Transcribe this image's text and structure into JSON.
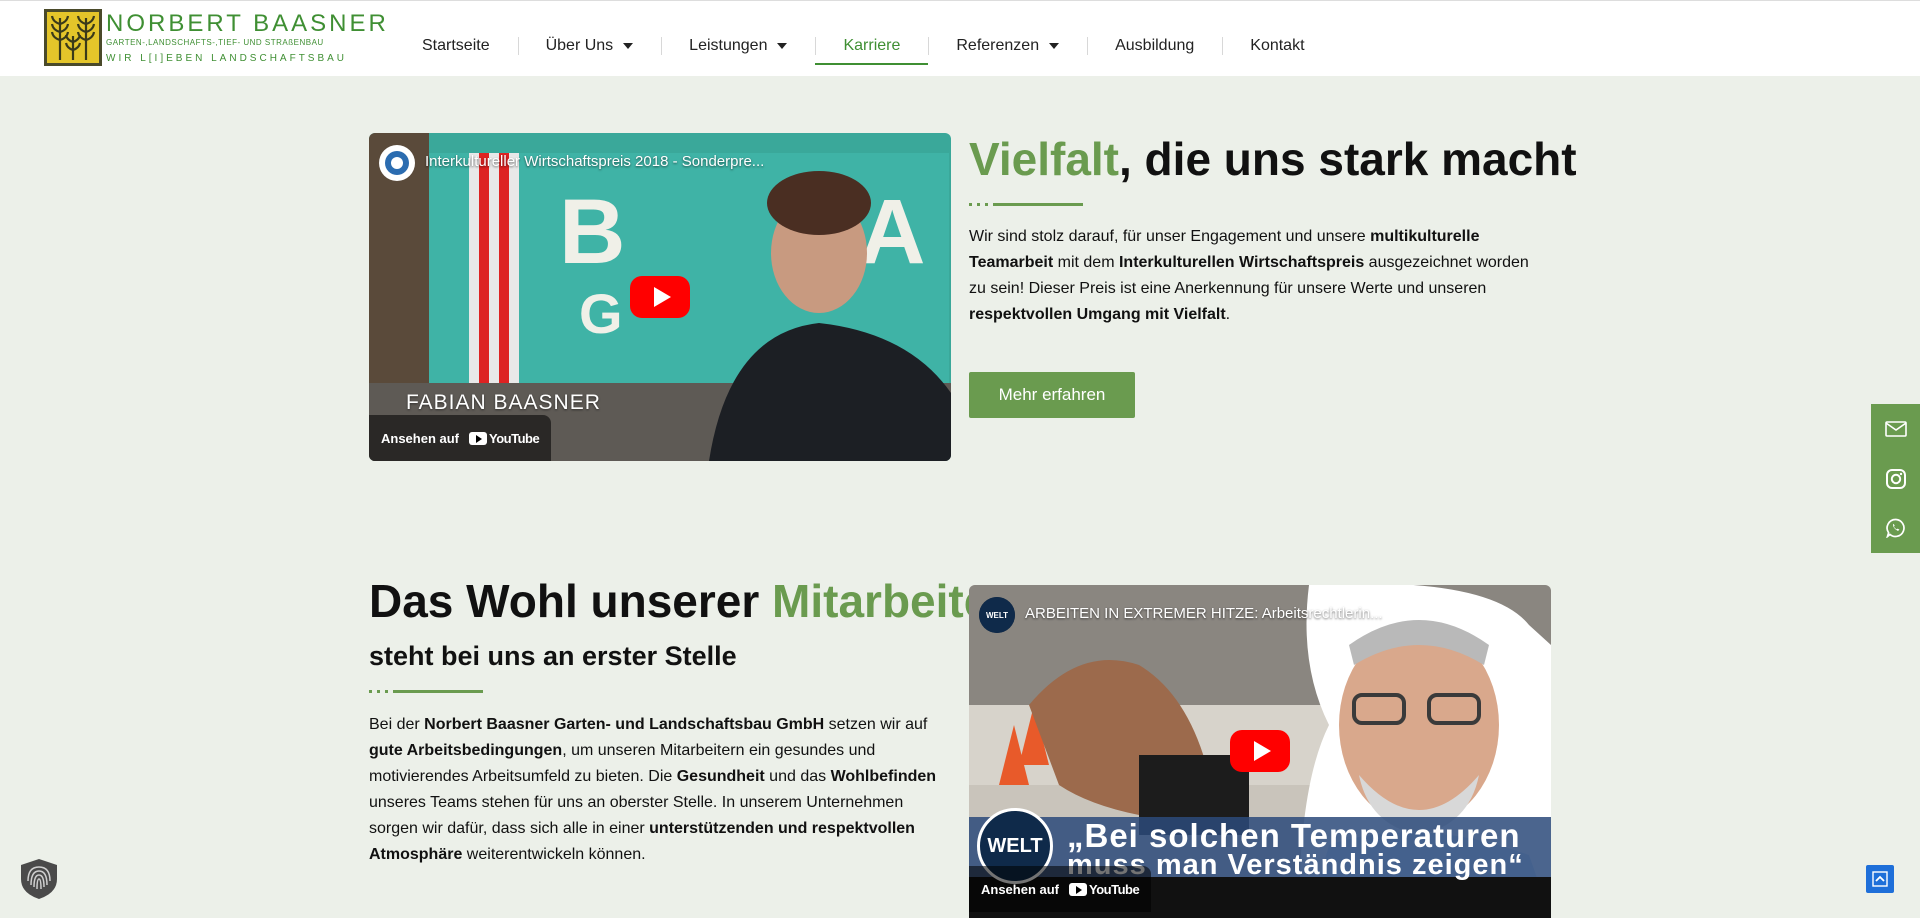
{
  "brand": {
    "name": "NORBERT BAASNER",
    "subtitle": "GARTEN-,LANDSCHAFTS-,TIEF- UND STRAßENBAU",
    "slogan": "WIR L[I]EBEN LANDSCHAFTSBAU",
    "color_green": "#3f8f33",
    "color_yellow": "#e4c52a"
  },
  "nav": {
    "items": [
      {
        "label": "Startseite",
        "dropdown": false
      },
      {
        "label": "Über Uns",
        "dropdown": true
      },
      {
        "label": "Leistungen",
        "dropdown": true
      },
      {
        "label": "Karriere",
        "dropdown": false,
        "active": true
      },
      {
        "label": "Referenzen",
        "dropdown": true
      },
      {
        "label": "Ausbildung",
        "dropdown": false
      },
      {
        "label": "Kontakt",
        "dropdown": false
      }
    ]
  },
  "section1": {
    "video": {
      "title": "Interkultureller Wirtschaftspreis 2018 - Sonderpre...",
      "overlay_name": "FABIAN BAASNER",
      "watch_label": "Ansehen auf",
      "platform": "YouTube"
    },
    "heading_highlight": "Vielfalt",
    "heading_rest": ", die uns stark macht",
    "para": {
      "t1": "Wir sind stolz darauf, für unser Engagement und unsere ",
      "b1": "multikulturelle Teamarbeit",
      "t2": " mit dem ",
      "b2": "Interkulturellen Wirtschaftspreis",
      "t3": " ausgezeichnet worden zu sein! Dieser Preis ist eine Anerkennung für unsere Werte und unseren ",
      "b3": "respektvollen Umgang mit Vielfalt",
      "t4": "."
    },
    "button": "Mehr erfahren"
  },
  "section2": {
    "heading_rest": "Das Wohl unserer ",
    "heading_highlight": "Mitarbeiter",
    "subheading": "steht bei uns an erster Stelle",
    "para": {
      "t1": "Bei der ",
      "b1": "Norbert Baasner Garten- und Landschaftsbau GmbH",
      "t2": " setzen wir auf ",
      "b2": "gute Arbeitsbedingungen",
      "t3": ", um unseren Mitarbeitern ein gesundes und motivierendes Arbeitsumfeld zu bieten. Die ",
      "b3": "Gesundheit",
      "t4": " und das ",
      "b4": "Wohlbefinden",
      "t5": " unseres Teams stehen für uns an oberster Stelle. In unserem Unternehmen sorgen wir dafür, dass sich alle in einer ",
      "b5": "unterstützenden und respektvollen Atmosphäre",
      "t6": " weiterentwickeln können."
    },
    "video": {
      "title": "ARBEITEN IN EXTREMER HITZE: Arbeitsrechtlerin...",
      "channel_badge": "WELT",
      "caption_line1": "„Bei solchen Temperaturen",
      "caption_line2": "muss man Verständnis zeigen“",
      "watch_label": "Ansehen auf",
      "platform": "YouTube"
    }
  },
  "social": {
    "icons": [
      "mail-icon",
      "instagram-icon",
      "whatsapp-icon"
    ],
    "color": "#6a9b4f"
  },
  "colors": {
    "accent_green": "#6a9b4f",
    "background": "#ecf0e9"
  }
}
